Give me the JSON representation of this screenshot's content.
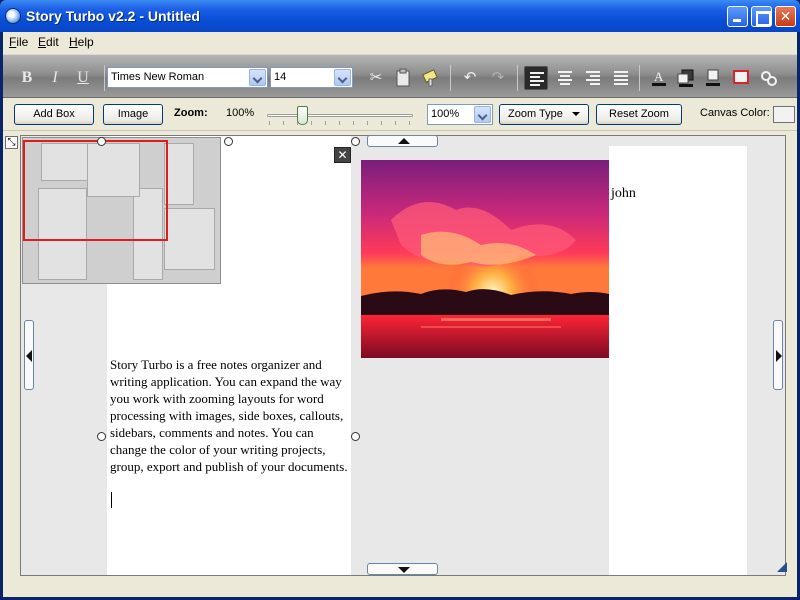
{
  "window": {
    "title": "Story Turbo v2.2 - Untitled",
    "controls": {
      "minimize": "minimize",
      "maximize": "maximize",
      "close": "✕"
    }
  },
  "menu": [
    {
      "accel": "F",
      "rest": "ile"
    },
    {
      "accel": "E",
      "rest": "dit"
    },
    {
      "accel": "H",
      "rest": "elp"
    }
  ],
  "format_toolbar": {
    "bold": "B",
    "italic": "I",
    "underline": "U",
    "font_family": "Times New Roman",
    "font_size": "14",
    "icons": [
      "cut-icon",
      "paste-icon",
      "format-painter-icon",
      "undo-icon",
      "redo-icon",
      "align-left-icon",
      "align-center-icon",
      "align-right-icon",
      "justify-icon",
      "font-color-icon",
      "highlight-icon",
      "background-color-icon",
      "border-color-icon",
      "link-icon"
    ]
  },
  "layout_toolbar": {
    "add_box": "Add Box",
    "image": "Image",
    "zoom_label": "Zoom:",
    "zoom_value": "100%",
    "zoom_slider_percent": 100,
    "zoom_select": "100%",
    "zoom_type": "Zoom Type",
    "reset_zoom": "Reset Zoom",
    "canvas_color_label": "Canvas Color:",
    "canvas_color": "#f2f2f2"
  },
  "canvas": {
    "close_label": "✕",
    "image_caption": "john",
    "story_text": "Story Turbo is a free notes organizer and writing application. You can expand the way you work with zooming layouts for word processing with images, side boxes, callouts, sidebars, comments and notes. You can change the color of your writing projects, group, export and publish of your documents.",
    "overview_highlight_color": "#e01d1d"
  }
}
